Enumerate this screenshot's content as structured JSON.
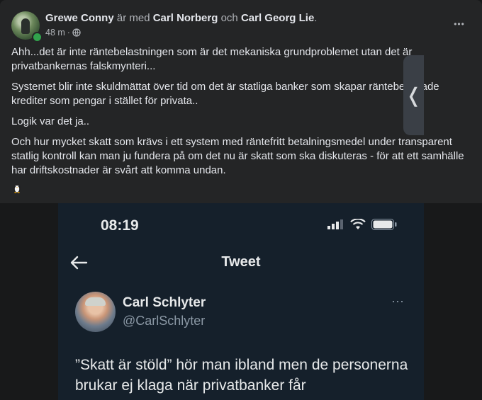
{
  "post": {
    "author": "Grewe Conny",
    "with_text": "är med",
    "tagged_1": "Carl Norberg",
    "and_text": "och",
    "tagged_2": "Carl Georg Lie",
    "period": ".",
    "time": "48 m",
    "separator": "·",
    "paragraphs": [
      "Ahh...det är inte räntebelastningen som är det mekaniska grundproblemet utan det är privatbankernas falskmynteri...",
      "Systemet blir inte skuldmättat över tid om det är statliga banker som skapar räntebelastade krediter som pengar i stället för privata..",
      "Logik var det ja..",
      "Och hur mycket skatt som krävs i ett system med räntefritt betalningsmedel under transparent statlig kontroll kan man ju fundera på om det nu är skatt som ska diskuteras - för att ett samhälle har driftskostnader är svårt att komma undan."
    ],
    "more_label": "•••",
    "emoji_name": "penguin-icon"
  },
  "screenshot": {
    "time": "08:19",
    "title": "Tweet",
    "author_name": "Carl Schlyter",
    "author_handle": "@CarlSchlyter",
    "more": "···",
    "body": "”Skatt är stöld” hör man ibland men de personerna brukar ej klaga när privatbanker får"
  },
  "side_handle_label": "❬",
  "colors": {
    "card_bg": "#242526",
    "page_bg": "#18191a",
    "text_primary": "#e4e6eb",
    "text_muted": "#b0b3b8",
    "online_green": "#31a24c",
    "twitter_bg": "#15202b"
  }
}
